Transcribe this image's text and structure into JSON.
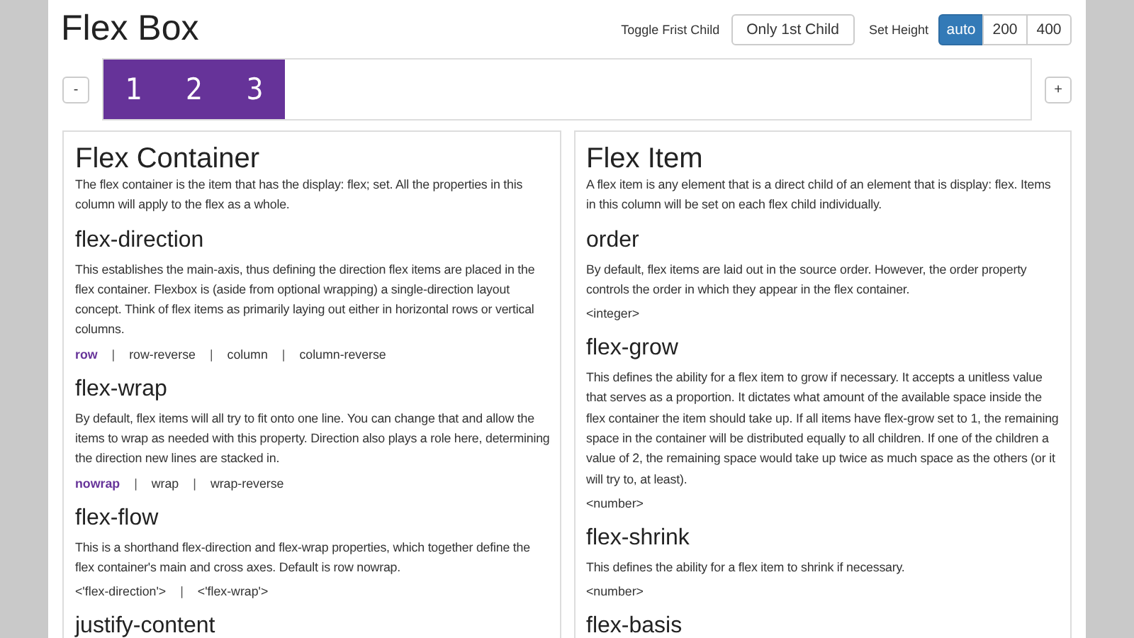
{
  "title": "Flex Box",
  "controls": {
    "toggle_label": "Toggle Frist Child",
    "toggle_button": "Only 1st Child",
    "height_label": "Set Height",
    "height_options": [
      {
        "label": "auto",
        "selected": true
      },
      {
        "label": "200",
        "selected": false
      },
      {
        "label": "400",
        "selected": false
      }
    ]
  },
  "demo": {
    "minus": "-",
    "plus": "+",
    "items": [
      "1",
      "2",
      "3"
    ]
  },
  "panels": [
    {
      "title": "Flex Container",
      "intro": "The flex container is the item that has the display: flex; set. All the properties in this column will apply to the flex as a whole.",
      "separator": "|",
      "sections": [
        {
          "heading": "flex-direction",
          "text": "This establishes the main-axis, thus defining the direction flex items are placed in the flex container. Flexbox is (aside from optional wrapping) a single-direction layout concept. Think of flex items as primarily laying out either in horizontal rows or vertical columns.",
          "options": [
            {
              "label": "row",
              "selected": true
            },
            {
              "label": "row-reverse",
              "selected": false
            },
            {
              "label": "column",
              "selected": false
            },
            {
              "label": "column-reverse",
              "selected": false
            }
          ]
        },
        {
          "heading": "flex-wrap",
          "text": "By default, flex items will all try to fit onto one line. You can change that and allow the items to wrap as needed with this property. Direction also plays a role here, determining the direction new lines are stacked in.",
          "options": [
            {
              "label": "nowrap",
              "selected": true
            },
            {
              "label": "wrap",
              "selected": false
            },
            {
              "label": "wrap-reverse",
              "selected": false
            }
          ]
        },
        {
          "heading": "flex-flow",
          "text": "This is a shorthand flex-direction and flex-wrap properties, which together define the flex container's main and cross axes. Default is row nowrap.",
          "options": [
            {
              "label": "<'flex-direction'>",
              "selected": false
            },
            {
              "label": "<'flex-wrap'>",
              "selected": false
            }
          ]
        },
        {
          "heading": "justify-content"
        }
      ]
    },
    {
      "title": "Flex Item",
      "intro": "A flex item is any element that is a direct child of an element that is display: flex. Items in this column will be set on each flex child individually.",
      "sections": [
        {
          "heading": "order",
          "text": "By default, flex items are laid out in the source order. However, the order property controls the order in which they appear in the flex container.",
          "options": [
            {
              "label": "<integer>",
              "selected": false
            }
          ]
        },
        {
          "heading": "flex-grow",
          "text": "This defines the ability for a flex item to grow if necessary. It accepts a unitless value that serves as a proportion. It dictates what amount of the available space inside the flex container the item should take up. If all items have flex-grow set to 1, the remaining space in the container will be distributed equally to all children. If one of the children a value of 2, the remaining space would take up twice as much space as the others (or it will try to, at least).",
          "options": [
            {
              "label": "<number>",
              "selected": false
            }
          ]
        },
        {
          "heading": "flex-shrink",
          "text": "This defines the ability for a flex item to shrink if necessary.",
          "options": [
            {
              "label": "<number>",
              "selected": false
            }
          ]
        },
        {
          "heading": "flex-basis"
        }
      ]
    }
  ]
}
